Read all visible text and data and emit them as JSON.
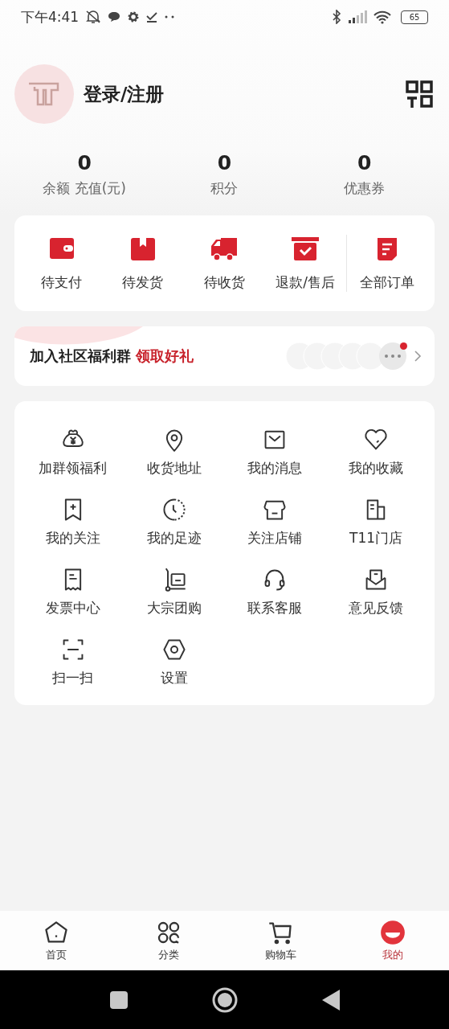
{
  "status_bar": {
    "time": "下午4:41",
    "battery": "65"
  },
  "profile": {
    "login_label": "登录/注册"
  },
  "stats": [
    {
      "value": "0",
      "label": "余额 充值(元)"
    },
    {
      "value": "0",
      "label": "积分"
    },
    {
      "value": "0",
      "label": "优惠券"
    }
  ],
  "orders": [
    {
      "label": "待支付"
    },
    {
      "label": "待发货"
    },
    {
      "label": "待收货"
    },
    {
      "label": "退款/售后"
    },
    {
      "label": "全部订单"
    }
  ],
  "community_banner": {
    "title": "加入社区福利群",
    "highlight": "领取好礼"
  },
  "services": [
    {
      "label": "加群领福利"
    },
    {
      "label": "收货地址"
    },
    {
      "label": "我的消息"
    },
    {
      "label": "我的收藏"
    },
    {
      "label": "我的关注"
    },
    {
      "label": "我的足迹"
    },
    {
      "label": "关注店铺"
    },
    {
      "label": "T11门店"
    },
    {
      "label": "发票中心"
    },
    {
      "label": "大宗团购"
    },
    {
      "label": "联系客服"
    },
    {
      "label": "意见反馈"
    },
    {
      "label": "扫一扫"
    },
    {
      "label": "设置"
    }
  ],
  "tabs": [
    {
      "label": "首页",
      "selected": false
    },
    {
      "label": "分类",
      "selected": false
    },
    {
      "label": "购物车",
      "selected": false
    },
    {
      "label": "我的",
      "selected": true
    }
  ]
}
